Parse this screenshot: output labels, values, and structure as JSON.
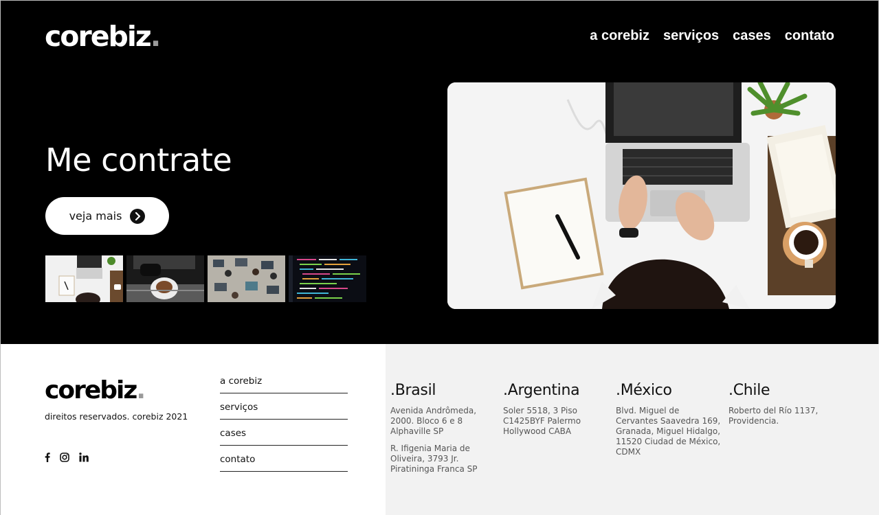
{
  "header": {
    "logo_text": "corebiz",
    "logo_dot": ".",
    "nav": [
      "a corebiz",
      "serviços",
      "cases",
      "contato"
    ]
  },
  "hero": {
    "headline": "Me contrate",
    "cta_label": "veja mais",
    "thumbnails": [
      "laptop-desk-thumbnail",
      "espresso-machine-thumbnail",
      "team-workspace-thumbnail",
      "code-screen-thumbnail"
    ]
  },
  "footer": {
    "logo_text": "corebiz",
    "logo_dot": ".",
    "rights": "direitos reservados. corebiz 2021",
    "social": [
      "facebook-icon",
      "instagram-icon",
      "linkedin-icon"
    ],
    "nav": [
      "a corebiz",
      "serviços",
      "cases",
      "contato"
    ],
    "countries": [
      {
        "name": ".Brasil",
        "addresses": [
          "Avenida Andrômeda,\n2000. Bloco 6 e 8\nAlphaville SP",
          "R. Ifigenia Maria de\nOliveira, 3793 Jr.\nPiratininga Franca SP"
        ]
      },
      {
        "name": ".Argentina",
        "addresses": [
          "Soler 5518, 3 Piso\nC1425BYF Palermo\nHollywood CABA"
        ]
      },
      {
        "name": ".México",
        "addresses": [
          "Blvd. Miguel de\nCervantes Saavedra 169,\nGranada, Miguel Hidalgo,\n11520 Ciudad de México,\nCDMX"
        ]
      },
      {
        "name": ".Chile",
        "addresses": [
          "Roberto del Río 1137,\nProvidencia."
        ]
      }
    ]
  },
  "colors": {
    "hero_bg": "#000000",
    "footer_right_bg": "#f2f2f2",
    "logo_dot": "#9a9a9a"
  }
}
